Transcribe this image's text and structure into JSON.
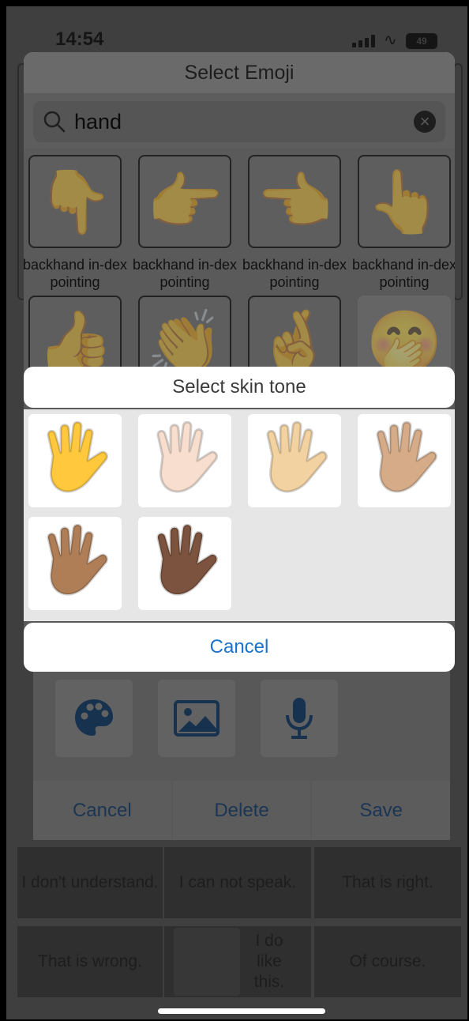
{
  "status_bar": {
    "time": "14:54",
    "battery": "49"
  },
  "picker": {
    "title": "Select Emoji",
    "search_value": "hand",
    "results": [
      {
        "glyph": "👇",
        "caption": "backhand in-dex pointing"
      },
      {
        "glyph": "👉",
        "caption": "backhand in-dex pointing"
      },
      {
        "glyph": "👈",
        "caption": "backhand in-dex pointing"
      },
      {
        "glyph": "👆",
        "caption": "backhand in-dex pointing"
      },
      {
        "glyph": "👍"
      },
      {
        "glyph": "👏"
      },
      {
        "glyph": "🤞"
      },
      {
        "glyph": "🤭"
      }
    ]
  },
  "skin_tone": {
    "title": "Select skin tone",
    "cancel_label": "Cancel",
    "tones": [
      {
        "name": "default",
        "color": "#FFC83D"
      },
      {
        "name": "light",
        "color": "#F7DECE"
      },
      {
        "name": "medium-light",
        "color": "#F3D2A2"
      },
      {
        "name": "medium",
        "color": "#D5AB88"
      },
      {
        "name": "medium-dark",
        "color": "#AF7E57"
      },
      {
        "name": "dark",
        "color": "#7C533E"
      }
    ]
  },
  "editor": {
    "cancel_label": "Cancel",
    "delete_label": "Delete",
    "save_label": "Save"
  },
  "phrases": [
    "I don't understand.",
    "I can not speak.",
    "That is right.",
    "That is wrong.",
    "I do like this.",
    "Of course."
  ],
  "colors": {
    "accent": "#1A73CC",
    "dim_accent": "#1B3554"
  }
}
